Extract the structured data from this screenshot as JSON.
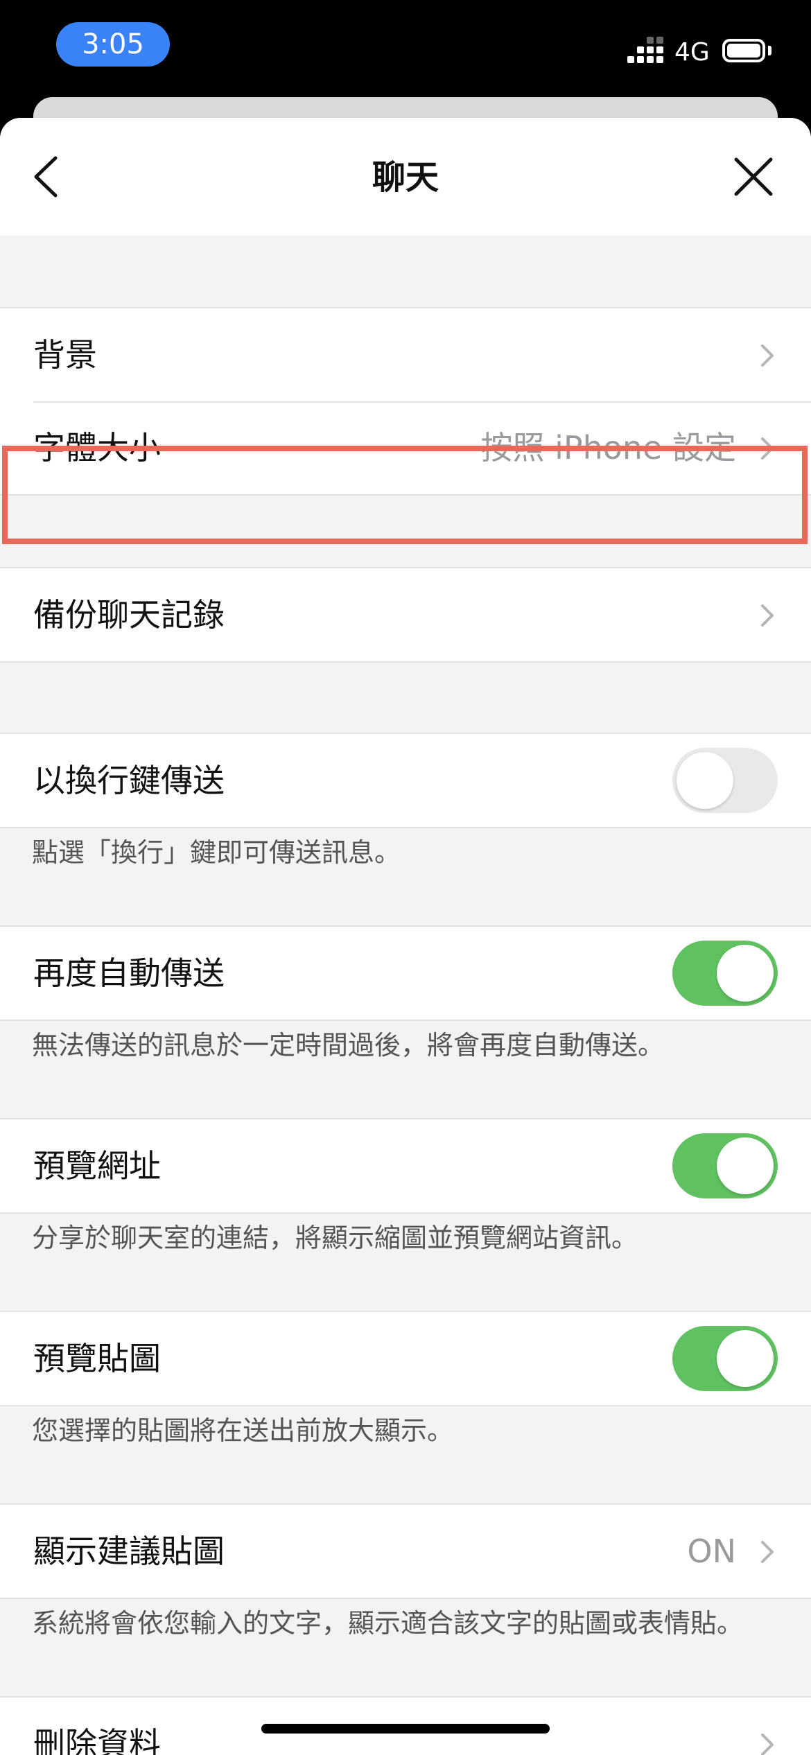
{
  "status": {
    "time": "3:05",
    "network": "4G"
  },
  "nav": {
    "title": "聊天",
    "back_icon": "chevron-left-icon",
    "close_icon": "close-icon"
  },
  "display": {
    "background_label": "背景",
    "font_size_label": "字體大小",
    "font_size_value": "按照 iPhone 設定"
  },
  "backup": {
    "label": "備份聊天記錄"
  },
  "settings": {
    "return_send": {
      "label": "以換行鍵傳送",
      "enabled": false,
      "note": "點選「換行」鍵即可傳送訊息。"
    },
    "auto_resend": {
      "label": "再度自動傳送",
      "enabled": true,
      "note": "無法傳送的訊息於一定時間過後，將會再度自動傳送。"
    },
    "url_preview": {
      "label": "預覽網址",
      "enabled": true,
      "note": "分享於聊天室的連結，將顯示縮圖並預覽網站資訊。"
    },
    "sticker_preview": {
      "label": "預覽貼圖",
      "enabled": true,
      "note": "您選擇的貼圖將在送出前放大顯示。"
    },
    "suggest_stickers": {
      "label": "顯示建議貼圖",
      "value": "ON",
      "note": "系統將會依您輸入的文字，顯示適合該文字的貼圖或表情貼。"
    },
    "delete_data": {
      "label": "刪除資料"
    }
  },
  "colors": {
    "accent_green": "#60c160",
    "highlight": "#e8685a",
    "time_pill": "#3a82f7"
  }
}
